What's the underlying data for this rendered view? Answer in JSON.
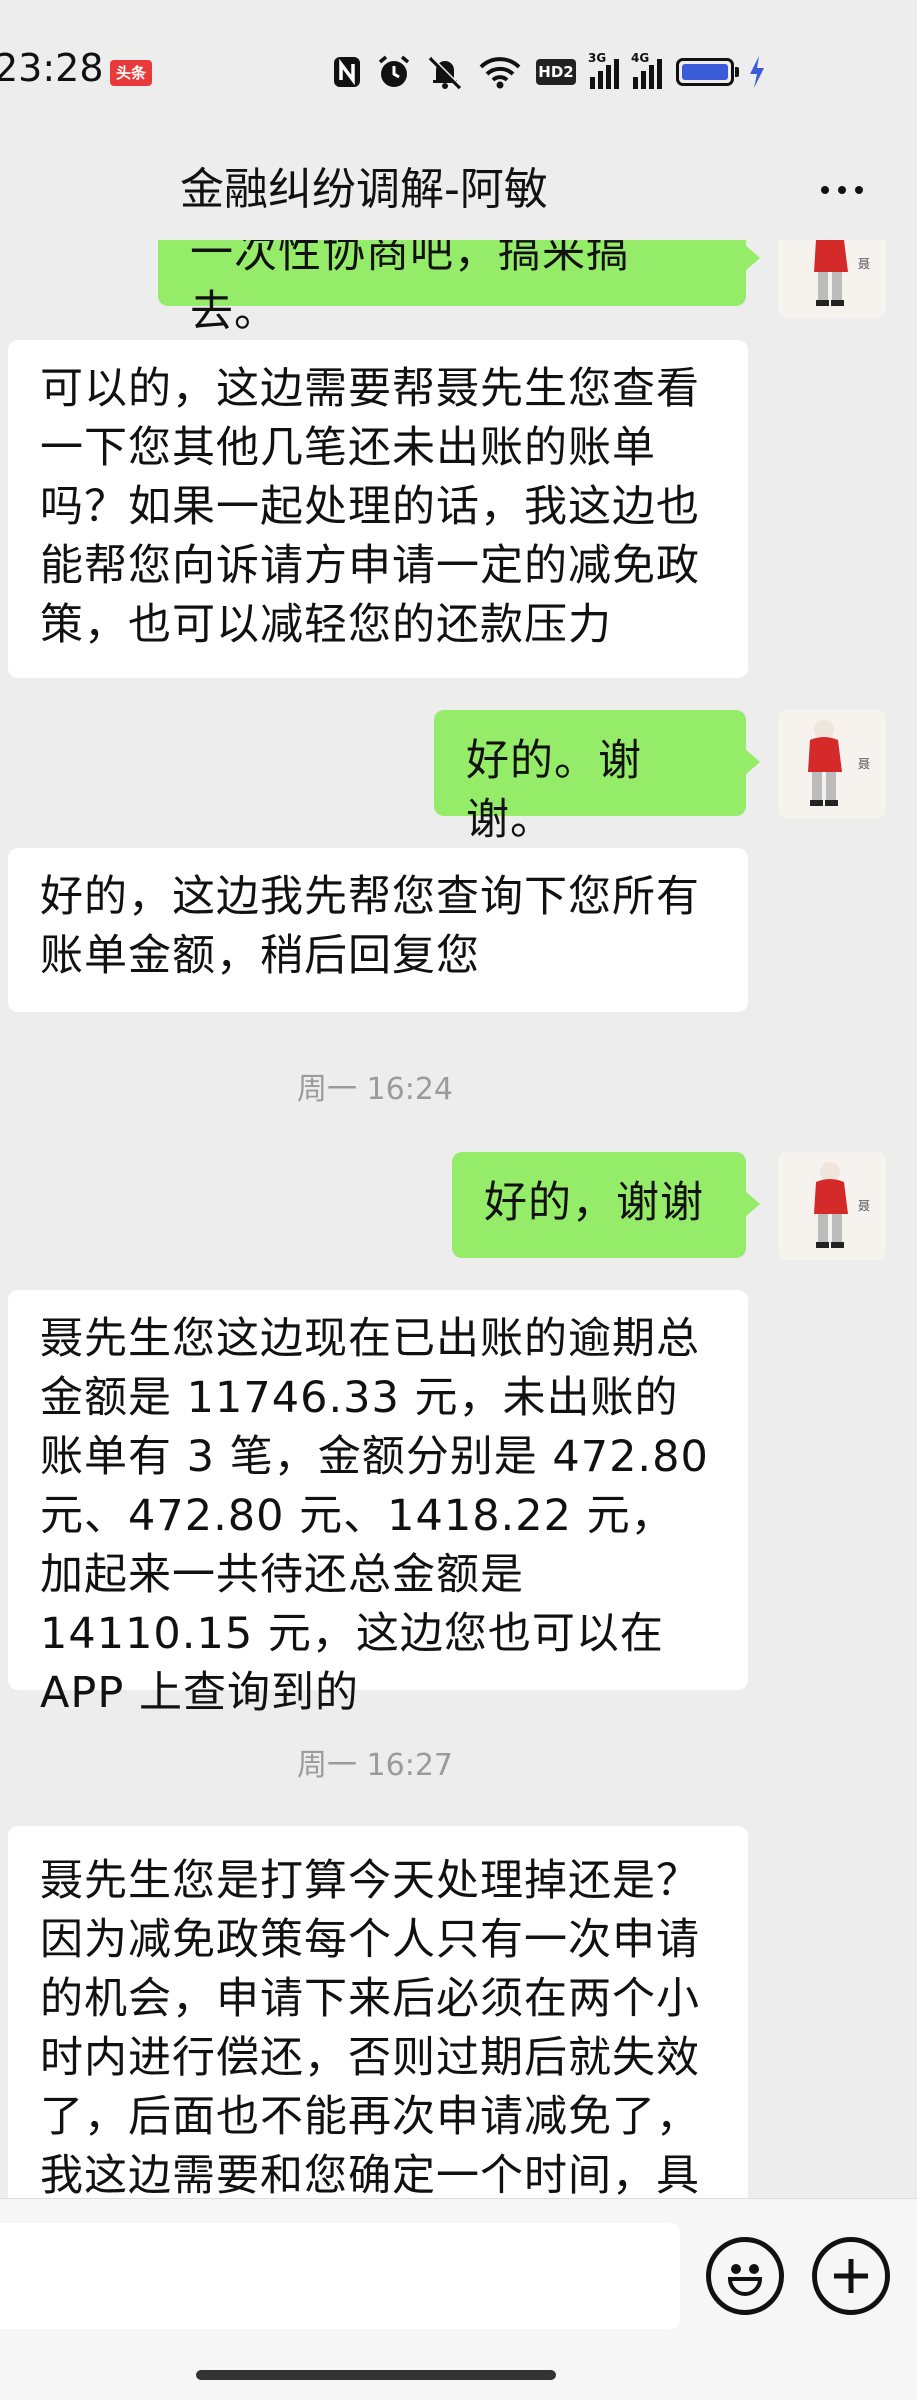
{
  "status_bar": {
    "time": "23:28",
    "badge": "头条",
    "hd_label": "HD2",
    "network_1": "3G",
    "network_2": "4G"
  },
  "header": {
    "title": "金融纠纷调解-阿敏"
  },
  "messages": [
    {
      "side": "out",
      "text": "一次性协商吧，搞来搞去。"
    },
    {
      "side": "in",
      "text": "可以的，这边需要帮聂先生您查看一下您其他几笔还未出账的账单吗？如果一起处理的话，我这边也能帮您向诉请方申请一定的减免政策，也可以减轻您的还款压力"
    },
    {
      "side": "out",
      "text": "好的。谢谢。"
    },
    {
      "side": "in",
      "text": "好的，这边我先帮您查询下您所有账单金额，稍后回复您"
    },
    {
      "side": "time",
      "text": "周一 16:24"
    },
    {
      "side": "out",
      "text": "好的，谢谢"
    },
    {
      "side": "in",
      "text": "聂先生您这边现在已出账的逾期总金额是 11746.33 元，未出账的账单有 3 笔，金额分别是 472.80 元、472.80 元、1418.22 元，加起来一共待还总金额是 14110.15 元，这边您也可以在 APP 上查询到的"
    },
    {
      "side": "time",
      "text": "周一 16:27"
    },
    {
      "side": "in",
      "text": "聂先生您是打算今天处理掉还是？因为减免政策每个人只有一次申请的机会，申请下来后必须在两个小时内进行偿还，否则过期后就失效了，后面也不能再次申请减免了，我这边需要和您确定一个时间，具"
    }
  ],
  "colors": {
    "background": "#ededed",
    "outgoing_bubble": "#95ec69",
    "incoming_bubble": "#ffffff",
    "timestamp_text": "#9b9b9b"
  },
  "icons": {
    "more": "more-dots-icon",
    "emoji": "emoji-icon",
    "add": "plus-icon"
  }
}
